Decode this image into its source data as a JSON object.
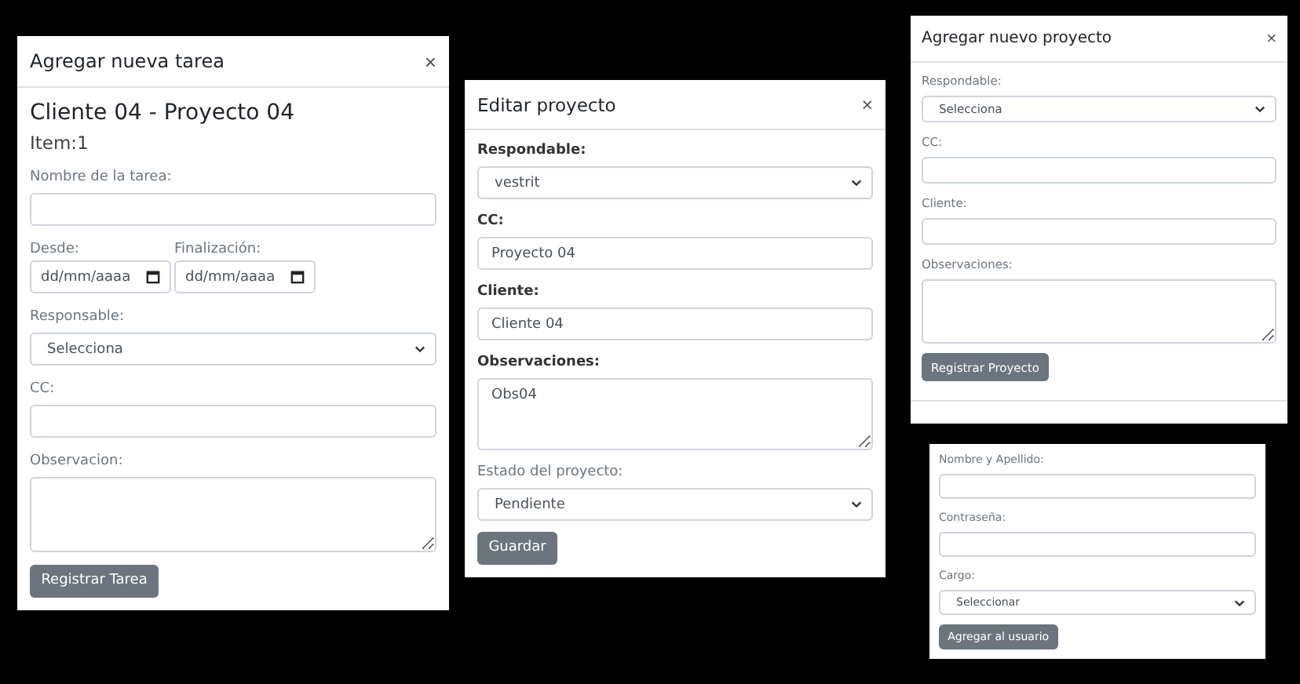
{
  "panels": [
    {
      "title": "Agregar nueva tarea",
      "close": "×",
      "heading": "Cliente 04 - Proyecto 04",
      "subheading": "Item:1",
      "fields": [
        {
          "kind": "text",
          "label": "Nombre de la tarea:",
          "bold": false
        },
        {
          "kind": "dates",
          "items": [
            {
              "label": "Desde:",
              "placeholder": "dd/mm/aaaa"
            },
            {
              "label": "Finalización:",
              "placeholder": "dd/mm/aaaa"
            }
          ]
        },
        {
          "kind": "select",
          "label": "Responsable:",
          "bold": false,
          "value": "Selecciona"
        },
        {
          "kind": "text",
          "label": "CC:",
          "bold": false
        },
        {
          "kind": "textarea",
          "label": "Observacion:",
          "bold": false
        }
      ],
      "button": "Registrar Tarea"
    },
    {
      "title": "Editar proyecto",
      "close": "×",
      "fields": [
        {
          "kind": "select",
          "label": "Respondable:",
          "bold": true,
          "value": "vestrit"
        },
        {
          "kind": "text",
          "label": "CC:",
          "bold": true,
          "value": "Proyecto 04"
        },
        {
          "kind": "text",
          "label": "Cliente:",
          "bold": true,
          "value": "Cliente 04"
        },
        {
          "kind": "textarea",
          "label": "Observaciones:",
          "bold": true,
          "value": "Obs04"
        },
        {
          "kind": "select",
          "label": "Estado del proyecto:",
          "bold": false,
          "value": "Pendiente"
        }
      ],
      "button": "Guardar"
    },
    {
      "title": "Agregar nuevo proyecto",
      "close": "×",
      "fields": [
        {
          "kind": "select",
          "label": "Respondable:",
          "bold": false,
          "value": "Selecciona"
        },
        {
          "kind": "text",
          "label": "CC:",
          "bold": false
        },
        {
          "kind": "text",
          "label": "Cliente:",
          "bold": false
        },
        {
          "kind": "textarea",
          "label": "Observaciones:",
          "bold": false
        }
      ],
      "button": "Registrar Proyecto",
      "footer": true
    },
    {
      "fields": [
        {
          "kind": "text",
          "label": "Nombre y Apellido:",
          "bold": false
        },
        {
          "kind": "text",
          "label": "Contraseña:",
          "bold": false
        },
        {
          "kind": "select",
          "label": "Cargo:",
          "bold": false,
          "value": "Seleccionar"
        }
      ],
      "button": "Agregar al usuario"
    }
  ]
}
